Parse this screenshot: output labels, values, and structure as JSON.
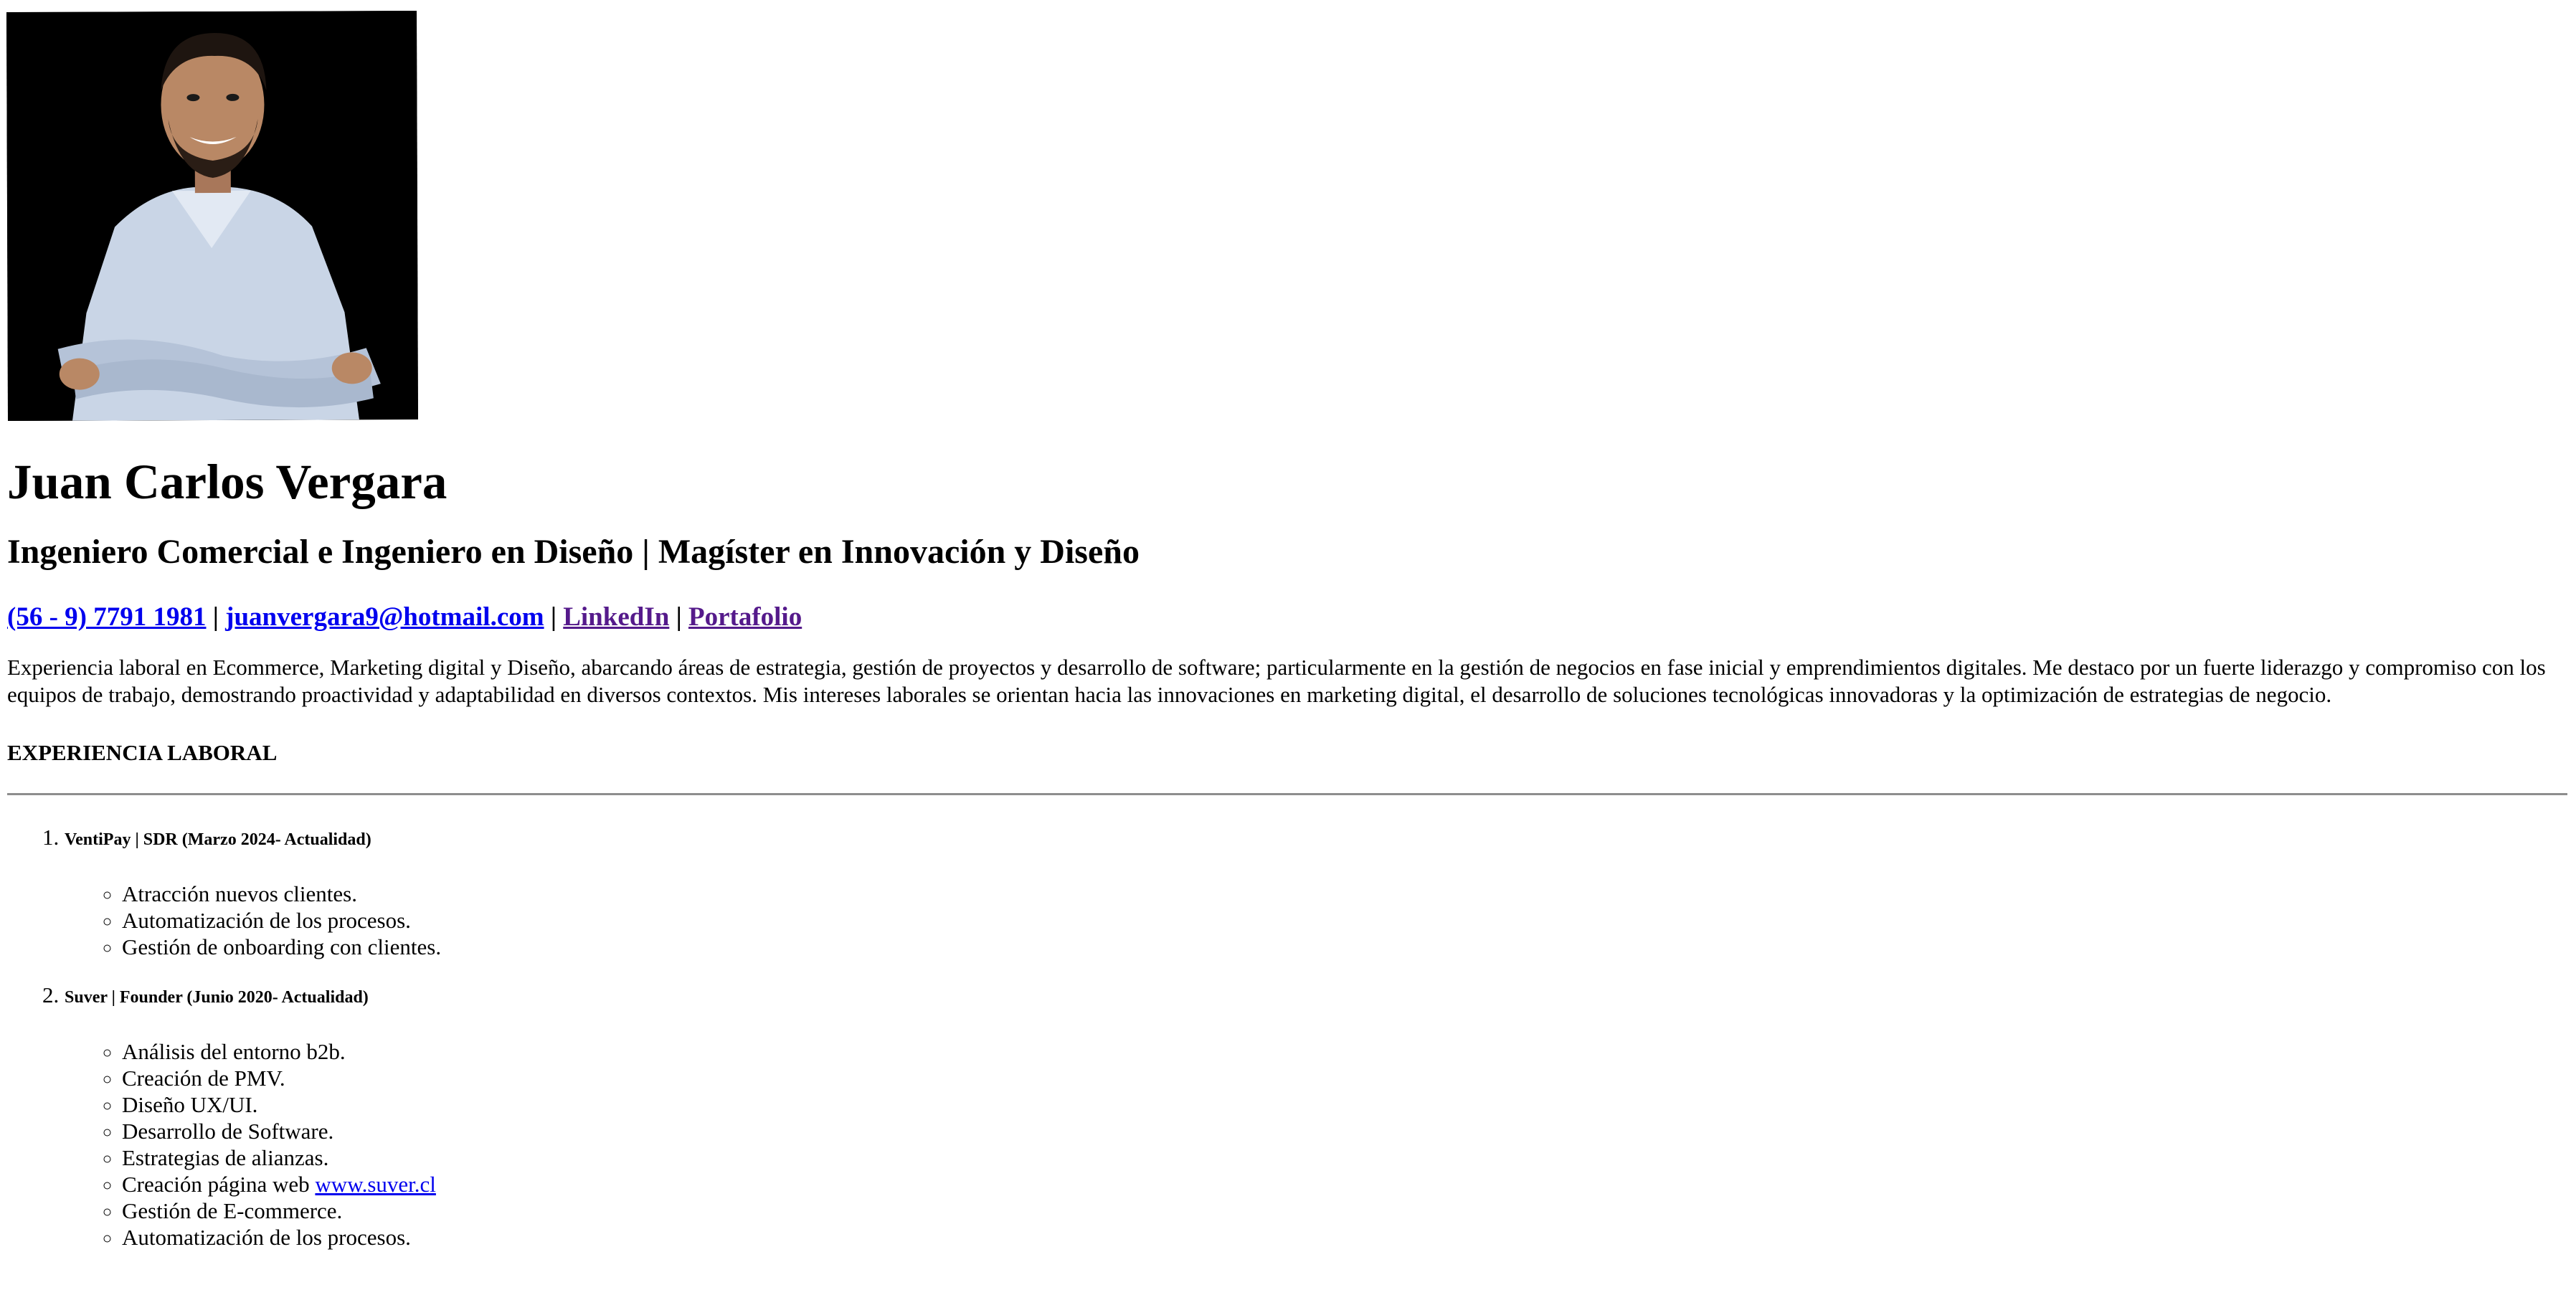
{
  "profile": {
    "photo_icon": "profile-photo",
    "name": "Juan Carlos Vergara",
    "headline": "Ingeniero Comercial e Ingeniero en Diseño | Magíster en Innovación y Diseño"
  },
  "contact": {
    "phone": "(56 - 9) 7791 1981",
    "email": "juanvergara9@hotmail.com",
    "linkedin": "LinkedIn",
    "portfolio": "Portafolio",
    "separator": " | ",
    "link_color": "#0000ee",
    "visited_color": "#551a8b"
  },
  "summary": "Experiencia laboral en Ecommerce, Marketing digital y Diseño, abarcando áreas de estrategia, gestión de proyectos y desarrollo de software; particularmente en la gestión de negocios en fase inicial y emprendimientos digitales. Me destaco por un fuerte liderazgo y compromiso con los equipos de trabajo, demostrando proactividad y adaptabilidad en diversos contextos. Mis intereses laborales se orientan hacia las innovaciones en marketing digital, el desarrollo de soluciones tecnológicas innovadoras y la optimización de estrategias de negocio.",
  "experience": {
    "title": "EXPERIENCIA LABORAL",
    "jobs": [
      {
        "title": "VentiPay | SDR (Marzo 2024- Actualidad)",
        "tasks": [
          "Atracción nuevos clientes.",
          "Automatización de los procesos.",
          "Gestión de onboarding con clientes."
        ]
      },
      {
        "title": "Suver | Founder (Junio 2020- Actualidad)",
        "tasks": [
          "Análisis del entorno b2b.",
          "Creación de PMV.",
          "Diseño UX/UI.",
          "Desarrollo de Software.",
          "Estrategias de alianzas.",
          "Creación página web ",
          "Gestión de E-commerce.",
          "Automatización de los procesos."
        ],
        "web_link": "www.suver.cl"
      }
    ]
  }
}
